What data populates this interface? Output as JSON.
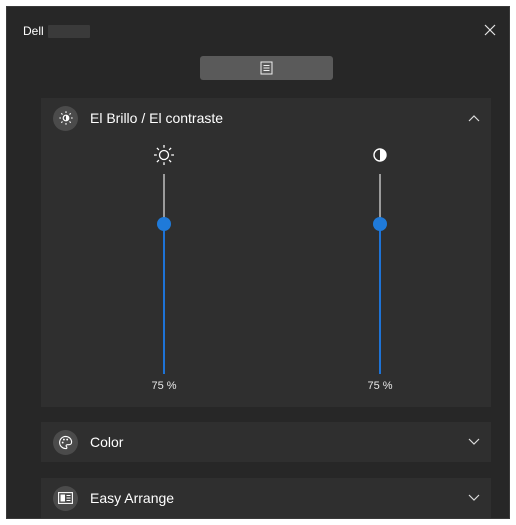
{
  "window": {
    "title": "Dell",
    "close_icon": "close-icon"
  },
  "toolbar": {
    "menu_icon": "list-document-icon"
  },
  "sections": [
    {
      "label": "El Brillo / El contraste",
      "icon": "brightness-contrast-icon",
      "expanded": true,
      "chevron": "chevron-up-icon"
    },
    {
      "label": "Color",
      "icon": "palette-icon",
      "expanded": false,
      "chevron": "chevron-down-icon"
    },
    {
      "label": "Easy Arrange",
      "icon": "easy-arrange-icon",
      "expanded": false,
      "chevron": "chevron-down-icon"
    }
  ],
  "brightness": {
    "icon": "sun-icon",
    "value": 75,
    "value_label": "75 %"
  },
  "contrast": {
    "icon": "contrast-icon",
    "value": 75,
    "value_label": "75 %"
  },
  "colors": {
    "accent": "#1F7AD9",
    "background": "#272727",
    "panel": "#2F2F2F"
  }
}
